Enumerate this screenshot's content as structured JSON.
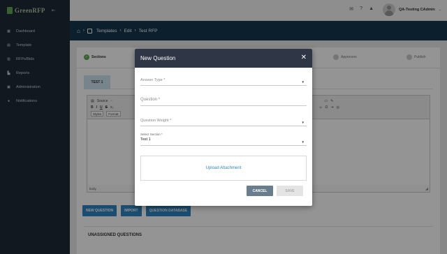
{
  "sidebar": {
    "logo": "GreenRFP",
    "collapse_icon": "menu-collapse-icon",
    "items": [
      {
        "label": "Dashboard",
        "icon": "grid-icon"
      },
      {
        "label": "Template",
        "icon": "document-icon"
      },
      {
        "label": "RFPs/Bids",
        "icon": "stack-icon"
      },
      {
        "label": "Reports",
        "icon": "chart-icon"
      },
      {
        "label": "Administration",
        "icon": "admin-icon"
      },
      {
        "label": "Notifications",
        "icon": "bell-icon"
      }
    ]
  },
  "header": {
    "user_name": "QA-Testing CAdmin"
  },
  "breadcrumb": {
    "parts": [
      "Templates",
      "Edit",
      "Test RFP"
    ]
  },
  "steps": [
    {
      "label": "Sections",
      "done": true
    },
    {
      "label": "Approvers",
      "done": false
    },
    {
      "label": "Publish",
      "done": false
    }
  ],
  "section_tab": "TEST 1",
  "editor": {
    "source_label": "Source",
    "bold": "B",
    "italic": "I",
    "underline": "U",
    "strike": "S",
    "styles_label": "Styles",
    "format_label": "Format",
    "footer_path": "body"
  },
  "actions": {
    "new_question": "NEW QUESTION",
    "import": "IMPORT",
    "question_database": "QUESTION DATABASE"
  },
  "unassigned_heading": "UNASSIGNED QUESTIONS",
  "modal": {
    "title": "New Question",
    "answer_type_placeholder": "Answer Type *",
    "question_placeholder": "Question *",
    "question_weight_placeholder": "Question Weight *",
    "select_section_label": "Select Section *",
    "select_section_value": "Test 1",
    "upload_label": "Upload Attachment",
    "cancel_label": "CANCEL",
    "save_label": "SAVE"
  },
  "colors": {
    "sidebar_bg": "#1e2a36",
    "banner_bg": "#15364f",
    "modal_header": "#2f3645",
    "primary": "#2e86c1",
    "success": "#5fa854"
  }
}
